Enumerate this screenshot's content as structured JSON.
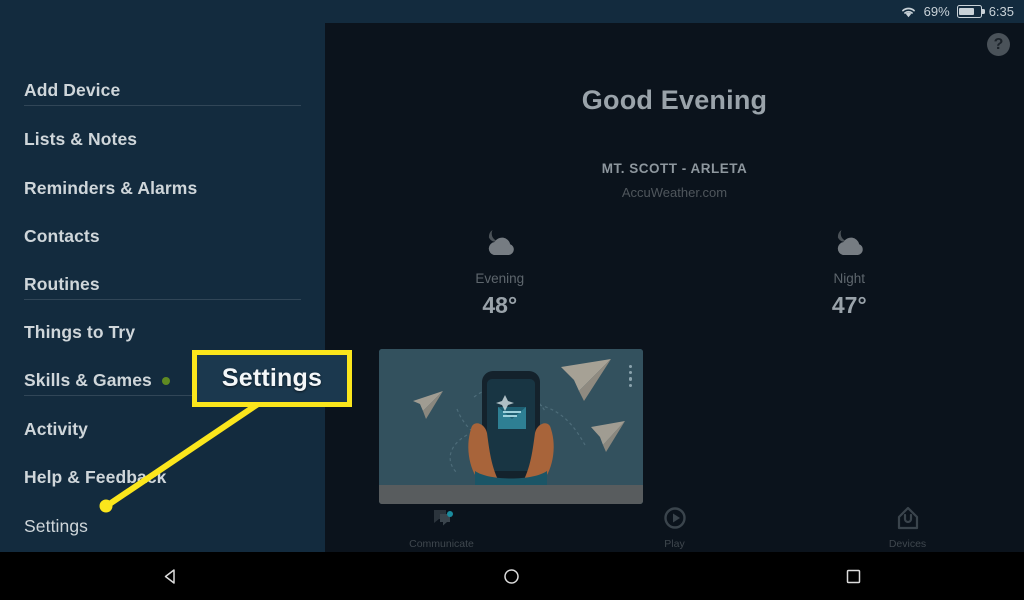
{
  "status_bar": {
    "wifi_icon": "wifi-icon",
    "battery_percent": "69%",
    "battery_icon": "battery-icon",
    "clock": "6:35"
  },
  "sidebar": {
    "items": [
      {
        "label": "Add Device",
        "bold": true,
        "dot": false
      },
      {
        "label": "Lists & Notes",
        "bold": true,
        "dot": false
      },
      {
        "label": "Reminders & Alarms",
        "bold": true,
        "dot": false
      },
      {
        "label": "Contacts",
        "bold": true,
        "dot": false
      },
      {
        "label": "Routines",
        "bold": true,
        "dot": false
      },
      {
        "label": "Things to Try",
        "bold": true,
        "dot": false
      },
      {
        "label": "Skills & Games",
        "bold": true,
        "dot": true
      },
      {
        "label": "Activity",
        "bold": true,
        "dot": false
      },
      {
        "label": "Help & Feedback",
        "bold": true,
        "dot": false
      },
      {
        "label": "Settings",
        "bold": false,
        "dot": false
      }
    ],
    "notification_dot_color": "#5f8a22"
  },
  "main": {
    "help_badge": "?",
    "greeting": "Good Evening",
    "weather": {
      "location": "MT. SCOTT - ARLETA",
      "source": "AccuWeather.com",
      "forecasts": [
        {
          "icon": "moon-cloud-icon",
          "label": "Evening",
          "temp": "48°"
        },
        {
          "icon": "moon-cloud-icon",
          "label": "Night",
          "temp": "47°"
        }
      ]
    },
    "promo_card": {
      "illustration": "hands-holding-phone-with-envelope-and-paper-planes-illustration",
      "menu_icon": "more-vertical-icon"
    },
    "tabs": [
      {
        "icon": "chat-bubbles-icon",
        "label": "Communicate",
        "badge": true
      },
      {
        "icon": "play-circle-icon",
        "label": "Play",
        "badge": false
      },
      {
        "icon": "devices-home-icon",
        "label": "Devices",
        "badge": false
      }
    ],
    "tab_badge_color": "#1a8c9e"
  },
  "annotation": {
    "callout_label": "Settings",
    "highlight_color": "#fbe61c"
  },
  "android_nav": {
    "back": "back-triangle-icon",
    "home": "home-circle-icon",
    "recents": "recents-square-icon"
  }
}
